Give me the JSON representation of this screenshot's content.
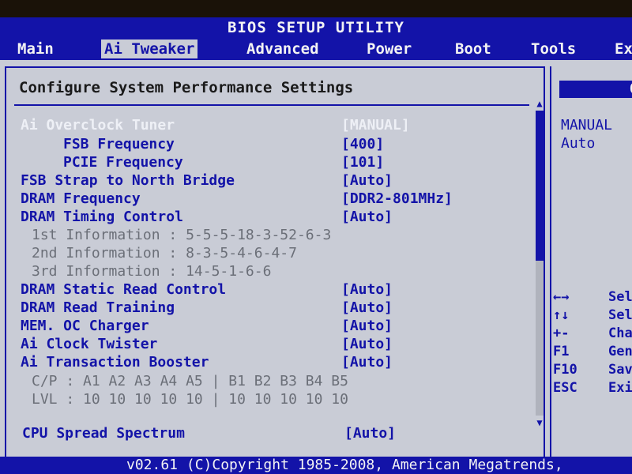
{
  "title": "BIOS SETUP UTILITY",
  "tabs": [
    {
      "label": "Main"
    },
    {
      "label": "Ai Tweaker"
    },
    {
      "label": "Advanced"
    },
    {
      "label": "Power"
    },
    {
      "label": "Boot"
    },
    {
      "label": "Tools"
    },
    {
      "label": "Ex"
    }
  ],
  "panel_title": "Configure System Performance Settings",
  "settings": [
    {
      "label": "Ai Overclock Tuner",
      "value": "[MANUAL]"
    },
    {
      "label": "FSB Frequency",
      "value": "[400]"
    },
    {
      "label": "PCIE Frequency",
      "value": "[101]"
    },
    {
      "label": "FSB Strap to North Bridge",
      "value": "[Auto]"
    },
    {
      "label": "DRAM Frequency",
      "value": "[DDR2-801MHz]"
    },
    {
      "label": "DRAM Timing Control",
      "value": "[Auto]"
    },
    {
      "label": "DRAM Static Read Control",
      "value": "[Auto]"
    },
    {
      "label": "DRAM Read Training",
      "value": "[Auto]"
    },
    {
      "label": "MEM. OC Charger",
      "value": "[Auto]"
    },
    {
      "label": "Ai Clock Twister",
      "value": "[Auto]"
    },
    {
      "label": "Ai Transaction Booster",
      "value": "[Auto]"
    },
    {
      "label": "CPU Spread Spectrum",
      "value": "[Auto]"
    }
  ],
  "timing_info": [
    {
      "label": "1st Information :",
      "value": "5-5-5-18-3-52-6-3"
    },
    {
      "label": "2nd Information :",
      "value": "8-3-5-4-6-4-7"
    },
    {
      "label": "3rd Information :",
      "value": "14-5-1-6-6"
    }
  ],
  "booster_table": {
    "cp_label": "C/P :",
    "cp_values": "A1 A2 A3 A4 A5 | B1 B2 B3 B4 B5",
    "lvl_label": "LVL :",
    "lvl_values": "10 10 10 10 10 | 10 10 10 10 10"
  },
  "side_panel": {
    "header": "O",
    "options": [
      "MANUAL",
      "Auto"
    ],
    "keys": [
      {
        "key": "←→",
        "desc": "Sel"
      },
      {
        "key": "↑↓",
        "desc": "Sel"
      },
      {
        "key": "+-",
        "desc": "Cha"
      },
      {
        "key": "F1",
        "desc": "Gen"
      },
      {
        "key": "F10",
        "desc": "Sav"
      },
      {
        "key": "ESC",
        "desc": "Exi"
      }
    ]
  },
  "footer": "v02.61 (C)Copyright 1985-2008, American Megatrends,",
  "colors": {
    "bios_blue": "#1313a8",
    "panel_bg": "#c9ccd6",
    "highlight": "#eef0f6",
    "info_gray": "#6b6f78"
  }
}
